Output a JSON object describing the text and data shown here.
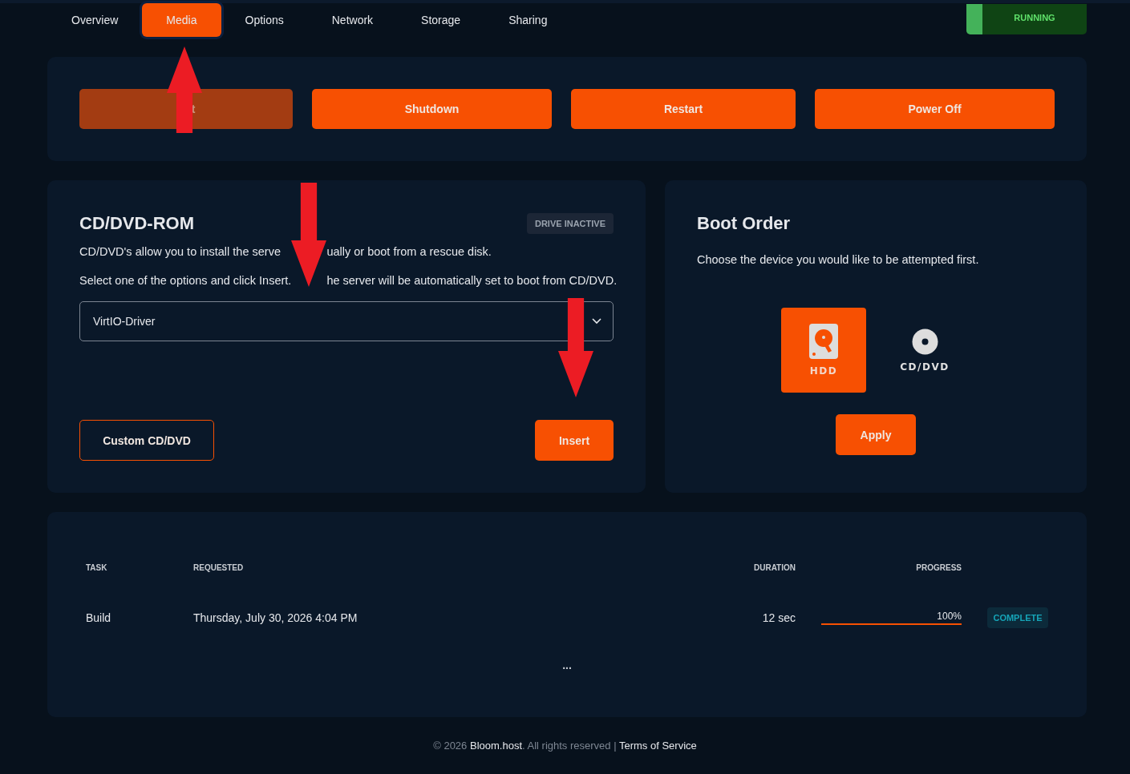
{
  "tabs": [
    {
      "label": "Overview",
      "selected": false
    },
    {
      "label": "Media",
      "selected": true
    },
    {
      "label": "Options",
      "selected": false
    },
    {
      "label": "Network",
      "selected": false
    },
    {
      "label": "Storage",
      "selected": false
    },
    {
      "label": "Sharing",
      "selected": false
    }
  ],
  "status": {
    "label": "RUNNING"
  },
  "power_buttons": [
    {
      "label": "t",
      "disabled": true
    },
    {
      "label": "Shutdown",
      "disabled": false
    },
    {
      "label": "Restart",
      "disabled": false
    },
    {
      "label": "Power Off",
      "disabled": false
    }
  ],
  "cd_rom": {
    "title": "CD/DVD-ROM",
    "badge": "DRIVE INACTIVE",
    "description_1": [
      "CD/DVD's allow you to install the serve",
      "ually or boot from a rescue disk."
    ],
    "description_2": [
      "Select one of the options and click Insert.",
      "he server will be automatically set to boot from CD/DVD."
    ],
    "select": {
      "value": "VirtIO-Driver"
    },
    "custom_button": "Custom CD/DVD",
    "insert_button": "Insert"
  },
  "boot_order": {
    "title": "Boot Order",
    "description": "Choose the device you would like to be attempted first.",
    "devices": [
      {
        "label": "HDD",
        "kind": "hdd",
        "selected": true
      },
      {
        "label": "CD/DVD",
        "kind": "disc",
        "selected": false
      }
    ],
    "apply_button": "Apply"
  },
  "tasks": {
    "columns": [
      "TASK",
      "REQUESTED",
      "DURATION",
      "PROGRESS"
    ],
    "rows": [
      {
        "task": "Build",
        "requested": "Thursday, July 30, 2026 4:04 PM",
        "duration": "12 sec",
        "progress": "100%",
        "level": 1,
        "status": "COMPLETE"
      }
    ],
    "more": "..."
  },
  "footer": {
    "copyright": "© 2026",
    "brand": "Bloom.host",
    "rights": ". All rights reserved",
    "separator": "|",
    "terms": "Terms of Service"
  }
}
